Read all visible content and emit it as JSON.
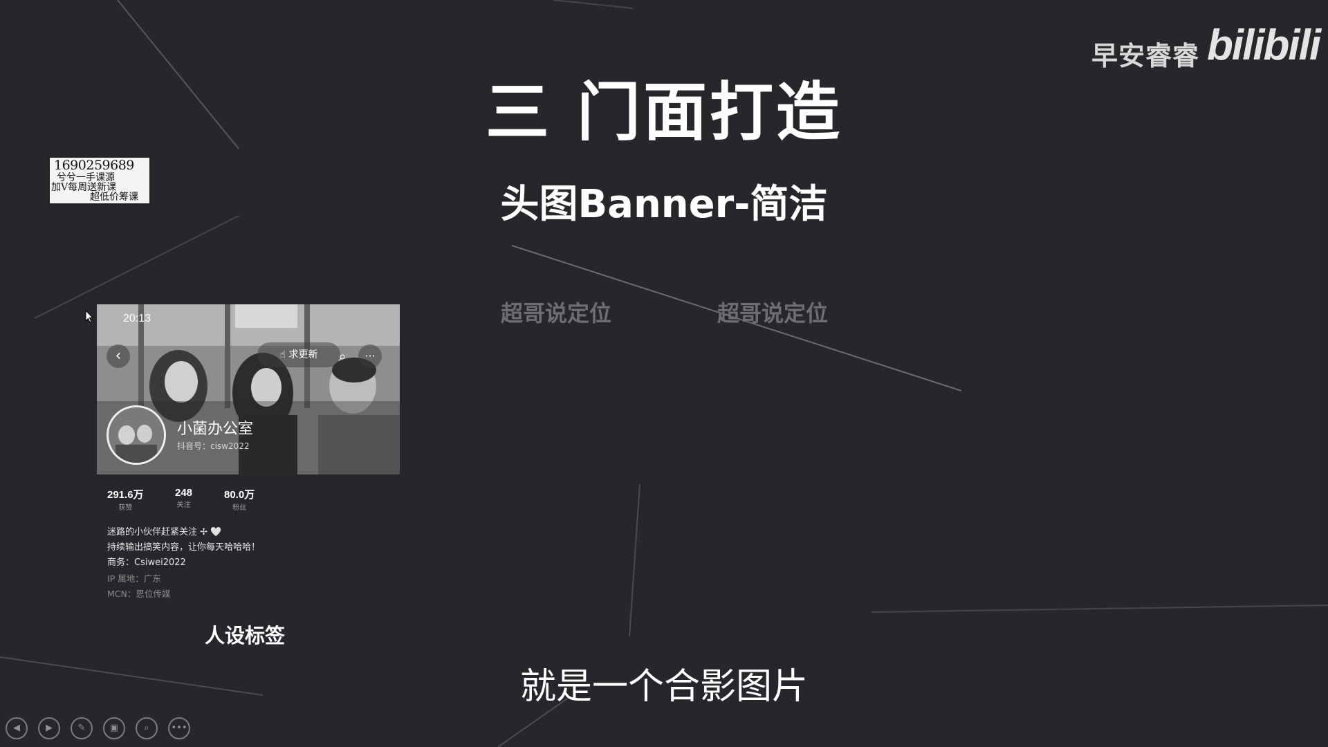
{
  "watermark": {
    "channel": "早安睿睿",
    "logo": "bilibili"
  },
  "slide": {
    "title": "三 门面打造",
    "subtitle": "头图Banner-简洁",
    "faded_texts": [
      "超哥说定位",
      "超哥说定位"
    ],
    "persona_label": "人设标签",
    "caption": "就是一个合影图片"
  },
  "sticker": {
    "line1": "1690259689",
    "line2": "兮兮一手课源",
    "line3": "加V每周送新课",
    "line4": "超低价筹课"
  },
  "profile": {
    "time": "20:13",
    "back_icon": "‹",
    "update_label": "求更新",
    "more_icon": "···",
    "name": "小菌办公室",
    "uid": "抖音号：cisw2022",
    "stats": [
      {
        "value": "291.6万",
        "label": "获赞"
      },
      {
        "value": "248",
        "label": "关注"
      },
      {
        "value": "80.0万",
        "label": "粉丝"
      }
    ],
    "bio": [
      "迷路的小伙伴赶紧关注 ✢ 🤍",
      "持续输出搞笑内容，让你每天哈哈哈！",
      "商务：Csiwei2022",
      "IP 属地：广东",
      "MCN：思位传媒"
    ]
  },
  "toolbar": {
    "items": [
      {
        "icon": "prev-icon",
        "glyph": "◀"
      },
      {
        "icon": "next-icon",
        "glyph": "▶"
      },
      {
        "icon": "pen-icon",
        "glyph": "✎"
      },
      {
        "icon": "slides-icon",
        "glyph": "▣"
      },
      {
        "icon": "zoom-icon",
        "glyph": "⌕"
      },
      {
        "icon": "more-icon",
        "glyph": "•••"
      }
    ]
  },
  "colors": {
    "background": "#25272b",
    "faded_text": "#6c6e72",
    "line": "#5a5c60"
  }
}
